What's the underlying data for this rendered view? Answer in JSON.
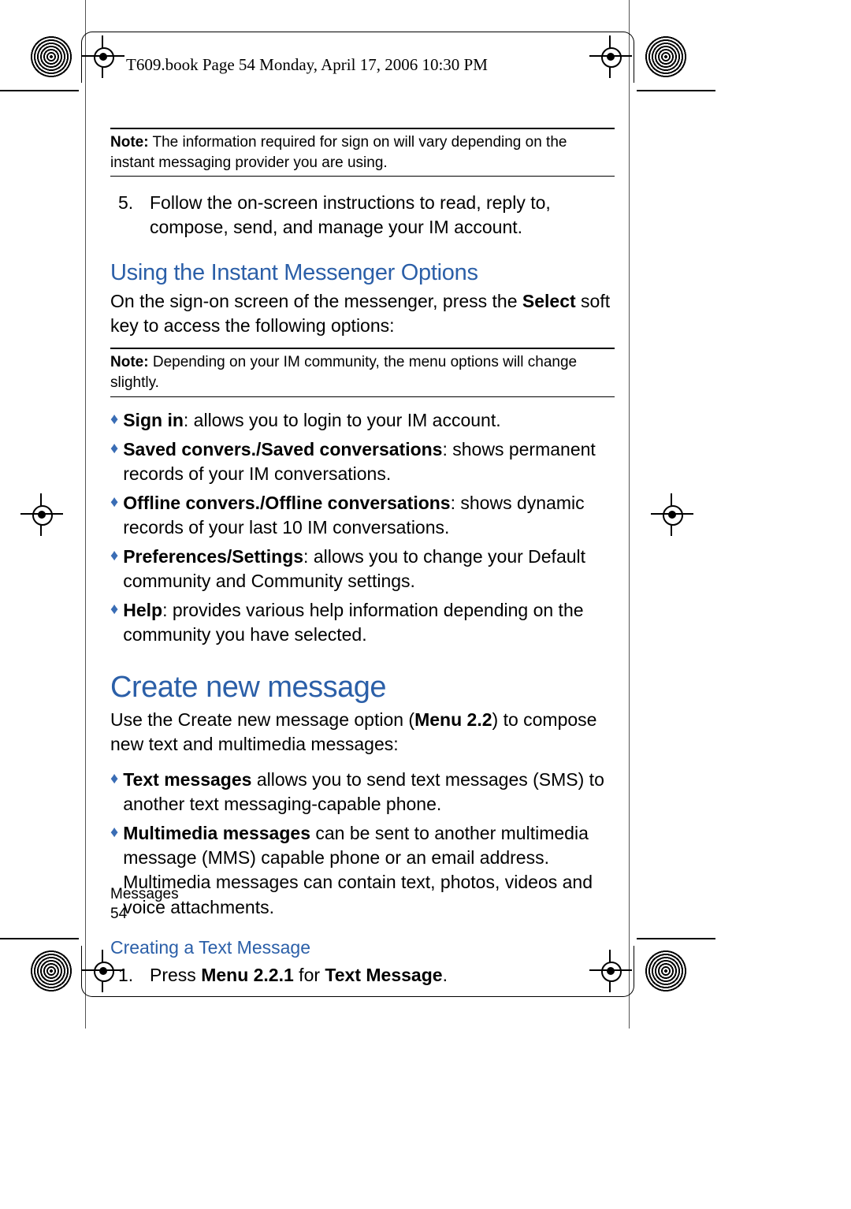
{
  "header": "T609.book  Page 54  Monday, April 17, 2006  10:30 PM",
  "note1_label": "Note:",
  "note1_text": " The information required for sign on will vary depending on the instant messaging provider you are using.",
  "step5_num": "5.",
  "step5_text": "Follow the on-screen instructions to read, reply to, compose, send, and manage your IM account.",
  "h2a": "Using the Instant Messenger Options",
  "p1_a": "On the sign-on screen of the messenger, press the ",
  "p1_bold": "Select",
  "p1_b": " soft key to access the following options:",
  "note2_label": "Note:",
  "note2_text": " Depending on your IM community, the menu options will change slightly.",
  "bullets1": [
    {
      "bold": "Sign in",
      "rest": ": allows you to login to your IM account."
    },
    {
      "bold": "Saved convers./Saved conversations",
      "rest": ": shows permanent records of your IM conversations."
    },
    {
      "bold": "Offline convers./Offline conversations",
      "rest": ": shows dynamic records of your last 10 IM conversations."
    },
    {
      "bold": "Preferences/Settings",
      "rest": ": allows you to change your Default community and Community settings."
    },
    {
      "bold": "Help",
      "rest": ": provides various help information depending on the community you have selected."
    }
  ],
  "h1": "Create new message",
  "p2_a": "Use the Create new message option (",
  "p2_bold": "Menu 2.2",
  "p2_b": ") to compose new text and multimedia messages:",
  "bullets2": [
    {
      "bold": "Text messages",
      "rest": " allows you to send text messages (SMS) to another text messaging-capable phone."
    },
    {
      "bold": "Multimedia messages",
      "rest": " can be sent to another multimedia message (MMS) capable phone or an email address. Multimedia messages can contain text, photos, videos and voice attachments."
    }
  ],
  "h3": "Creating a Text Message",
  "step1_num": "1.",
  "step1_a": "Press ",
  "step1_bold1": "Menu 2.2.1",
  "step1_b": " for ",
  "step1_bold2": "Text Message",
  "step1_c": ".",
  "footer_section": "Messages",
  "footer_page": "54"
}
